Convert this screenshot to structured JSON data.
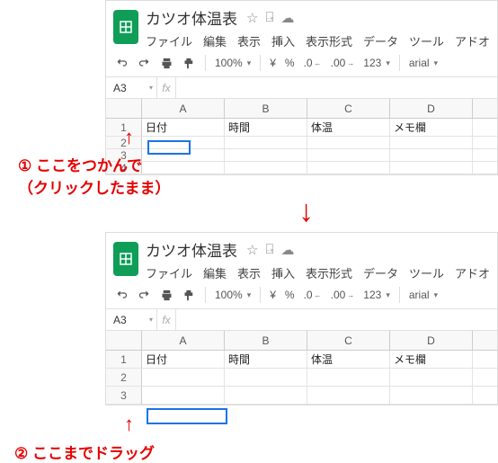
{
  "doc": {
    "title": "カツオ体温表",
    "menus": [
      "ファイル",
      "編集",
      "表示",
      "挿入",
      "表示形式",
      "データ",
      "ツール",
      "アドオ"
    ]
  },
  "toolbar": {
    "zoom": "100%",
    "currency": "¥",
    "percent": "%",
    "dec_dec": ".0",
    "dec_inc": ".00",
    "numfmt": "123",
    "font": "arial"
  },
  "namebox": {
    "ref": "A3"
  },
  "fx_label": "fx",
  "columns": [
    "A",
    "B",
    "C",
    "D"
  ],
  "rows1": [
    "1",
    "2",
    "3",
    "4"
  ],
  "rows2": [
    "1",
    "2",
    "3"
  ],
  "headers": {
    "A": "日付",
    "B": "時間",
    "C": "体温",
    "D": "メモ欄"
  },
  "anno": {
    "step1_num": "①",
    "step1a": "ここをつかんで",
    "step1b": "（クリックしたまま）",
    "step2_num": "②",
    "step2": "ここまでドラッグ"
  }
}
